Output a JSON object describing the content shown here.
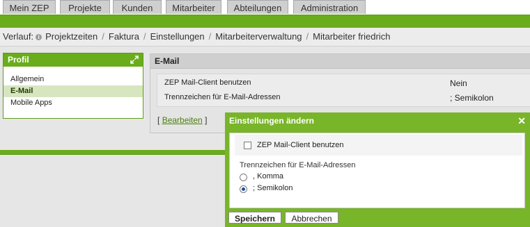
{
  "nav": {
    "tabs": [
      {
        "label": "Mein ZEP"
      },
      {
        "label": "Projekte"
      },
      {
        "label": "Kunden"
      },
      {
        "label": "Mitarbeiter"
      },
      {
        "label": "Abteilungen"
      },
      {
        "label": "Administration"
      }
    ]
  },
  "breadcrumb": {
    "label": "Verlauf:",
    "items": [
      "Projektzeiten",
      "Faktura",
      "Einstellungen",
      "Mitarbeiterverwaltung",
      "Mitarbeiter friedrich"
    ]
  },
  "profil": {
    "title": "Profil",
    "items": [
      {
        "label": "Allgemein"
      },
      {
        "label": "E-Mail"
      },
      {
        "label": "Mobile Apps"
      }
    ]
  },
  "email": {
    "title": "E-Mail",
    "rows": [
      {
        "label": "ZEP Mail-Client benutzen",
        "value": "Nein"
      },
      {
        "label": "Trennzeichen für E-Mail-Adressen",
        "value": "; Semikolon"
      }
    ],
    "edit_open": "[",
    "edit_label": "Bearbeiten",
    "edit_close": "]"
  },
  "dialog": {
    "title": "Einstellungen ändern",
    "close": "✕",
    "checkbox_label": "ZEP Mail-Client benutzen",
    "checkbox_checked": false,
    "separator_label": "Trennzeichen für E-Mail-Adressen",
    "options": [
      {
        "label": ", Komma",
        "selected": false
      },
      {
        "label": "; Semikolon",
        "selected": true
      }
    ],
    "save_label": "Speichern",
    "cancel_label": "Abbrechen"
  },
  "colors": {
    "accent_green": "#6aad1c",
    "dialog_green": "#79b529"
  }
}
